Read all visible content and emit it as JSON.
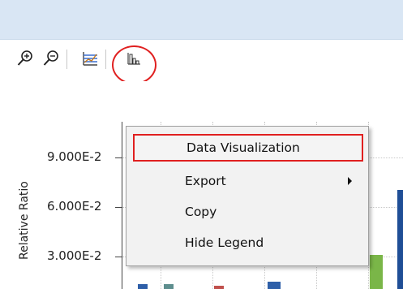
{
  "toolbar": {
    "buttons": [
      {
        "icon": "zoom-in-icon"
      },
      {
        "icon": "zoom-out-icon"
      },
      {
        "icon": "chart-lines-icon"
      },
      {
        "icon": "bar-chart-icon"
      }
    ]
  },
  "chart": {
    "y_axis_title": "Relative Ratio",
    "y_ticks": [
      "9.000E-2",
      "6.000E-2",
      "3.000E-2"
    ],
    "colors": {
      "bar_blue": "#2e5fa8",
      "bar_teal": "#5e8e8e",
      "bar_orange": "#c0504d",
      "bar_green": "#7ab648",
      "bar_darkblue": "#1f4e96"
    }
  },
  "context_menu": {
    "items": [
      {
        "label": "Data Visualization",
        "highlighted": true
      },
      {
        "label": "Export",
        "has_submenu": true
      },
      {
        "label": "Copy"
      },
      {
        "label": "Hide Legend"
      }
    ]
  },
  "colors": {
    "title_band": "#d9e6f4",
    "highlight": "#e02020",
    "menu_bg": "#f2f2f2"
  }
}
